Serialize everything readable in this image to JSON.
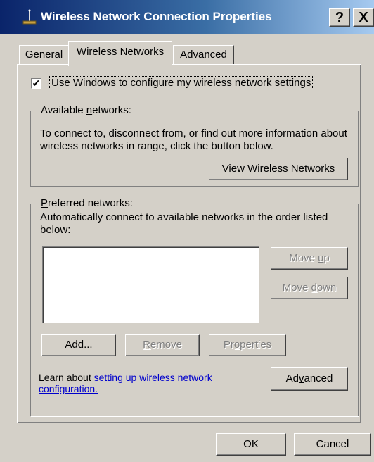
{
  "window": {
    "title": "Wireless Network Connection Properties",
    "help_label": "?",
    "close_label": "X"
  },
  "tabs": [
    {
      "label": "General",
      "active": false
    },
    {
      "label": "Wireless Networks",
      "active": true
    },
    {
      "label": "Advanced",
      "active": false
    }
  ],
  "use_windows": {
    "checked": true,
    "check_glyph": "✔",
    "pre": "Use ",
    "accel": "W",
    "post": "indows to configure my wireless network settings"
  },
  "available": {
    "label_pre": "Available ",
    "label_accel": "n",
    "label_post": "etworks:",
    "description": "To connect to, disconnect from, or find out more information about wireless networks in range, click the button below.",
    "view_button": "View Wireless Networks"
  },
  "preferred": {
    "label_accel": "P",
    "label_post": "referred networks:",
    "description": "Automatically connect to available networks in the order listed below:",
    "move_up_pre": "Move ",
    "move_up_accel": "u",
    "move_up_post": "p",
    "move_down_pre": "Move ",
    "move_down_accel": "d",
    "move_down_post": "own",
    "add_accel": "A",
    "add_post": "dd...",
    "remove_accel": "R",
    "remove_post": "emove",
    "properties_pre": "Pr",
    "properties_accel": "o",
    "properties_post": "perties",
    "learn_pre": "Learn about ",
    "learn_link": "setting up wireless network configuration.",
    "advanced_pre": "Ad",
    "advanced_accel": "v",
    "advanced_post": "anced"
  },
  "footer": {
    "ok": "OK",
    "cancel": "Cancel"
  },
  "colors": {
    "title_start": "#0a246a",
    "title_end": "#a6caf0",
    "face": "#d4d0c8",
    "link": "#0000cc"
  }
}
